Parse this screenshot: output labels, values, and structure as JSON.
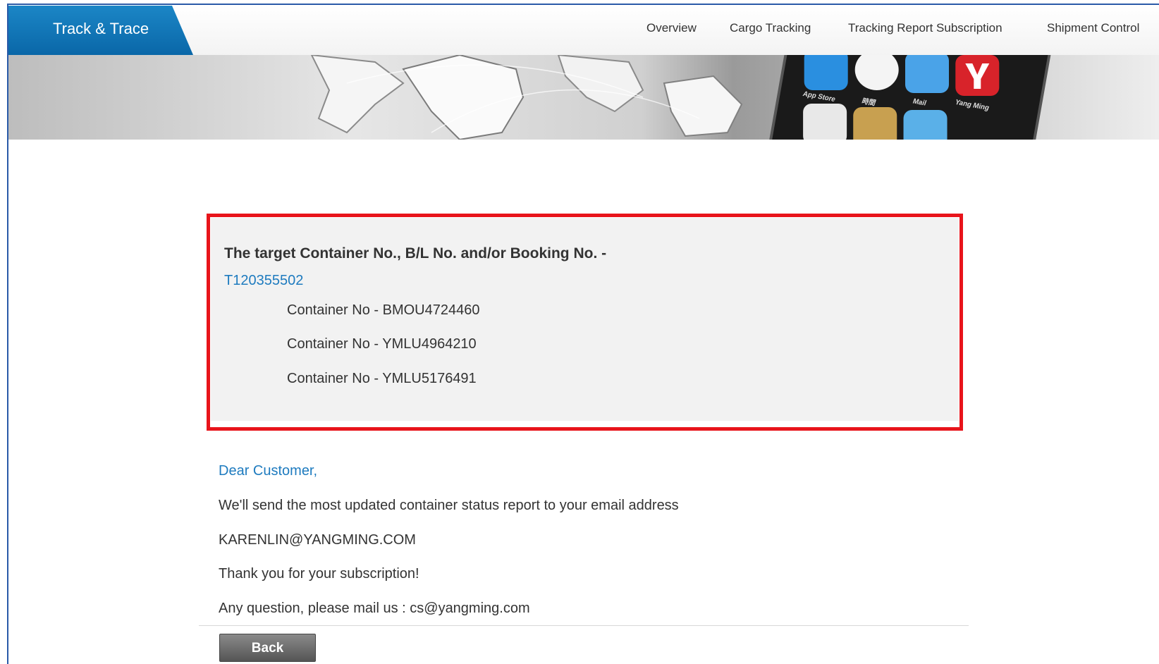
{
  "header": {
    "title": "Track & Trace",
    "nav": [
      {
        "label": "Overview"
      },
      {
        "label": "Cargo Tracking"
      },
      {
        "label": "Tracking Report Subscription"
      },
      {
        "label": "Shipment Control"
      }
    ]
  },
  "banner": {
    "apps": [
      {
        "label": "App Store",
        "icon": "app-store-icon",
        "color": "#2a8fe0"
      },
      {
        "label": "時間",
        "icon": "clock-icon",
        "color": "#f4f4f4"
      },
      {
        "label": "Mail",
        "icon": "mail-icon",
        "color": "#4aa3e8"
      },
      {
        "label": "Yang Ming",
        "icon": "yang-ming-logo-icon",
        "color": "#d8232a"
      }
    ]
  },
  "target": {
    "heading": "The target Container No., B/L No. and/or Booking No. -",
    "number": "T120355502",
    "containers": [
      "Container No - BMOU4724460",
      "Container No - YMLU4964210",
      "Container No - YMLU5176491"
    ]
  },
  "message": {
    "greeting": "Dear Customer,",
    "line1": "We'll send the most updated container status report to your email address",
    "email": "KARENLIN@YANGMING.COM",
    "thanks": "Thank you for your subscription!",
    "contact": "Any question, please mail us : cs@yangming.com"
  },
  "actions": {
    "back_label": "Back"
  },
  "colors": {
    "accent_blue": "#1e7bbf",
    "highlight_red": "#e8141b"
  }
}
